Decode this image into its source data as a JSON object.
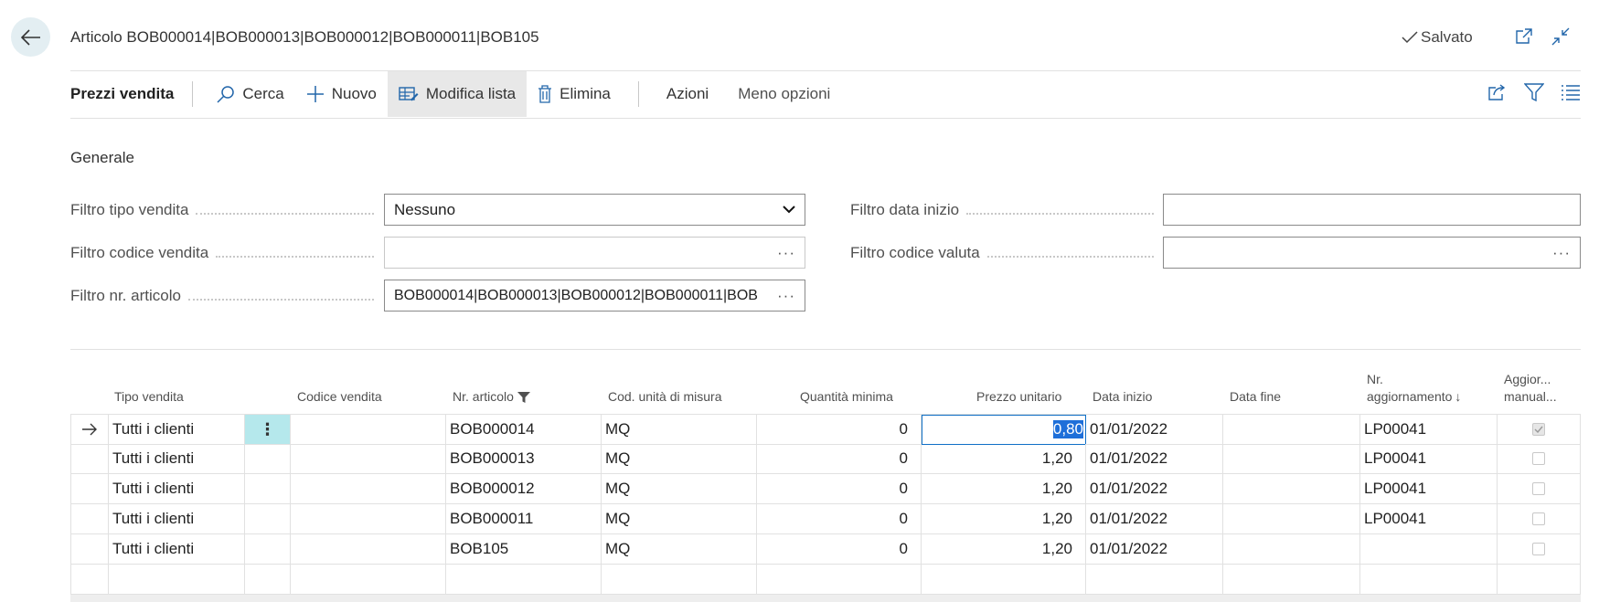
{
  "header": {
    "title": "Articolo BOB000014|BOB000013|BOB000012|BOB000011|BOB105",
    "saved_label": "Salvato"
  },
  "actionbar": {
    "page_name": "Prezzi vendita",
    "search_label": "Cerca",
    "new_label": "Nuovo",
    "edit_list_label": "Modifica lista",
    "delete_label": "Elimina",
    "actions_label": "Azioni",
    "fewer_options_label": "Meno opzioni"
  },
  "general": {
    "title": "Generale",
    "sales_type_filter_label": "Filtro tipo vendita",
    "sales_type_filter_value": "Nessuno",
    "sales_code_filter_label": "Filtro codice vendita",
    "sales_code_filter_value": "",
    "item_no_filter_label": "Filtro nr. articolo",
    "item_no_filter_value": "BOB000014|BOB000013|BOB000012|BOB000011|BOB",
    "start_date_filter_label": "Filtro data inizio",
    "start_date_filter_value": "",
    "currency_filter_label": "Filtro codice valuta",
    "currency_filter_value": ""
  },
  "grid": {
    "columns": {
      "sales_type": "Tipo vendita",
      "sales_code": "Codice vendita",
      "item_no": "Nr. articolo",
      "uom": "Cod. unità di misura",
      "min_qty": "Quantità minima",
      "unit_price": "Prezzo unitario",
      "start_date": "Data inizio",
      "end_date": "Data fine",
      "update_no_line1": "Nr.",
      "update_no_line2": "aggiornamento",
      "manual_line1": "Aggior...",
      "manual_line2": "manual..."
    },
    "rows": [
      {
        "sales_type": "Tutti i clienti",
        "sales_code": "",
        "item_no": "BOB000014",
        "uom": "MQ",
        "min_qty": "0",
        "unit_price": "0,80",
        "start_date": "01/01/2022",
        "end_date": "",
        "update_no": "LP00041",
        "manual": true
      },
      {
        "sales_type": "Tutti i clienti",
        "sales_code": "",
        "item_no": "BOB000013",
        "uom": "MQ",
        "min_qty": "0",
        "unit_price": "1,20",
        "start_date": "01/01/2022",
        "end_date": "",
        "update_no": "LP00041",
        "manual": false
      },
      {
        "sales_type": "Tutti i clienti",
        "sales_code": "",
        "item_no": "BOB000012",
        "uom": "MQ",
        "min_qty": "0",
        "unit_price": "1,20",
        "start_date": "01/01/2022",
        "end_date": "",
        "update_no": "LP00041",
        "manual": false
      },
      {
        "sales_type": "Tutti i clienti",
        "sales_code": "",
        "item_no": "BOB000011",
        "uom": "MQ",
        "min_qty": "0",
        "unit_price": "1,20",
        "start_date": "01/01/2022",
        "end_date": "",
        "update_no": "LP00041",
        "manual": false
      },
      {
        "sales_type": "Tutti i clienti",
        "sales_code": "",
        "item_no": "BOB105",
        "uom": "MQ",
        "min_qty": "0",
        "unit_price": "1,20",
        "start_date": "01/01/2022",
        "end_date": "",
        "update_no": "",
        "manual": false
      }
    ]
  },
  "colors": {
    "accent": "#0f6fc6",
    "back_button_bg": "#e3eef2",
    "row_menu_bg": "#b5e8ec",
    "active_button_bg": "#e8e8e8"
  }
}
